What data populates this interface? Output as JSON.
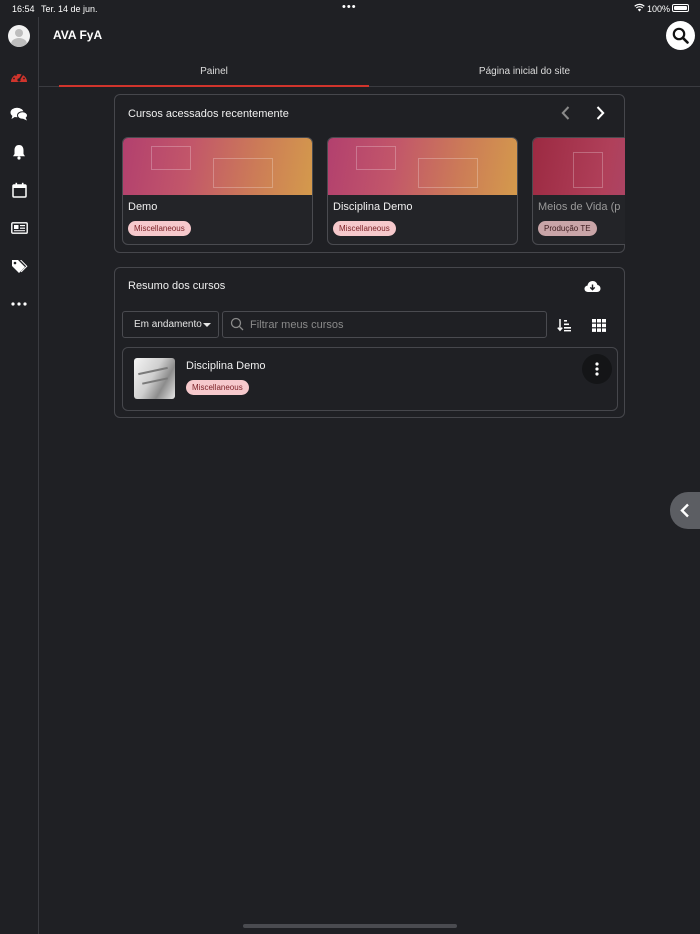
{
  "status_bar": {
    "time": "16:54",
    "date": "Ter. 14 de jun.",
    "battery": "100%"
  },
  "app": {
    "title": "AVA FyA"
  },
  "tabs": [
    {
      "label": "Painel",
      "active": true
    },
    {
      "label": "Página inicial do site",
      "active": false
    }
  ],
  "recent_courses": {
    "title": "Cursos acessados recentemente",
    "items": [
      {
        "name": "Demo",
        "category": "Miscellaneous"
      },
      {
        "name": "Disciplina Demo",
        "category": "Miscellaneous"
      },
      {
        "name": "Meios de Vida (p",
        "category": "Produção TE"
      }
    ]
  },
  "course_overview": {
    "title": "Resumo dos cursos",
    "filter_value": "Em andamento",
    "search_placeholder": "Filtrar meus cursos",
    "courses": [
      {
        "name": "Disciplina Demo",
        "category": "Miscellaneous"
      }
    ]
  },
  "colors": {
    "background": "#1f2024",
    "accent": "#d0342c",
    "badge_bg": "#f6c9cc",
    "badge_text": "#7a1f25"
  },
  "icons": {
    "sidebar": [
      "avatar",
      "dashboard-icon",
      "messages-icon",
      "notifications-icon",
      "calendar-icon",
      "grades-icon",
      "tags-icon",
      "more-icon"
    ],
    "header": [
      "search-icon"
    ]
  }
}
